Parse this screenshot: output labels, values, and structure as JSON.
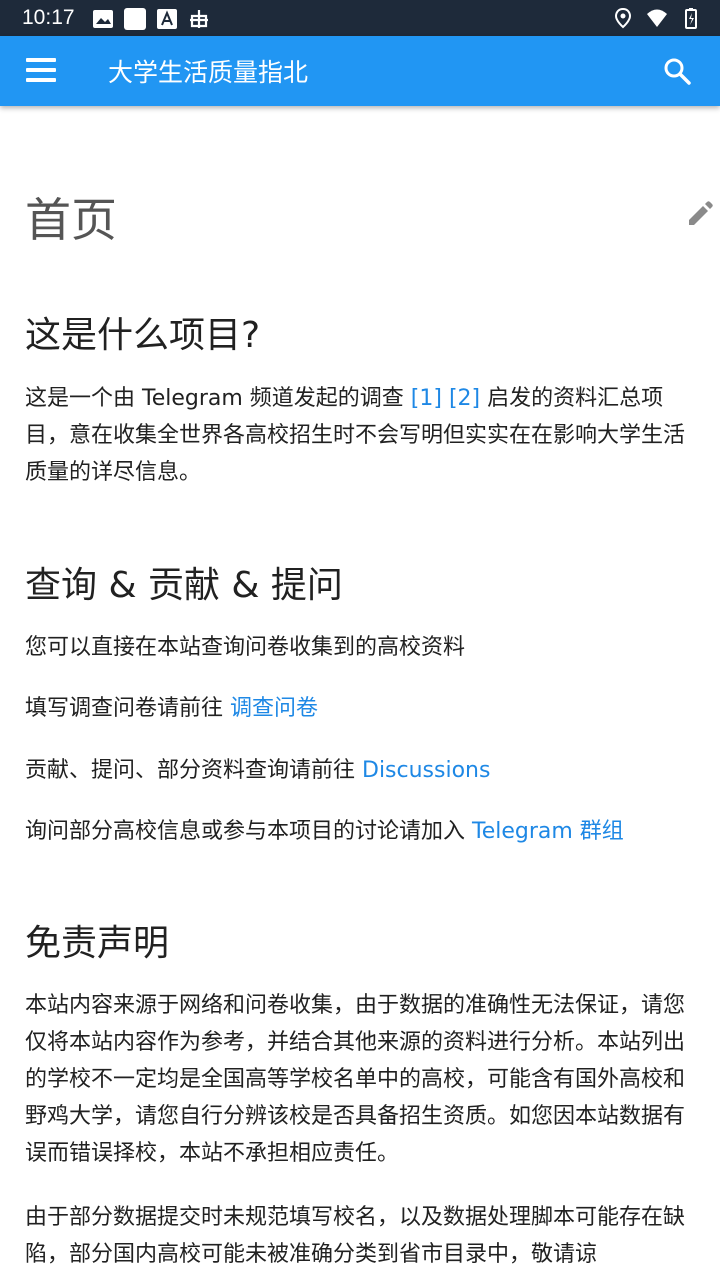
{
  "status_bar": {
    "time": "10:17",
    "icons_left": [
      "image-icon",
      "square-icon",
      "font-icon",
      "bug-icon"
    ],
    "icons_right": [
      "location-icon",
      "wifi-icon",
      "battery-icon"
    ]
  },
  "app_bar": {
    "title": "大学生活质量指北",
    "menu_icon": "menu-icon",
    "search_icon": "search-icon",
    "color": "#2196f3"
  },
  "page": {
    "title": "首页",
    "edit_icon": "pencil-icon"
  },
  "sections": {
    "about": {
      "heading": "这是什么项目?",
      "text_before": "这是一个由 Telegram 频道发起的调查 ",
      "ref1": "[1]",
      "ref2": "[2]",
      "text_after": " 启发的资料汇总项目，意在收集全世界各高校招生时不会写明但实实在在影响大学生活质量的详尽信息。"
    },
    "query": {
      "heading": "查询 & 贡献 & 提问",
      "line1": "您可以直接在本站查询问卷收集到的高校资料",
      "line2_text": "填写调查问卷请前往 ",
      "line2_link": "调查问卷",
      "line3_text": "贡献、提问、部分资料查询请前往 ",
      "line3_link": "Discussions",
      "line4_text": "询问部分高校信息或参与本项目的讨论请加入 ",
      "line4_link": "Telegram 群组"
    },
    "disclaimer": {
      "heading": "免责声明",
      "para1": "本站内容来源于网络和问卷收集，由于数据的准确性无法保证，请您仅将本站内容作为参考，并结合其他来源的资料进行分析。本站列出的学校不一定均是全国高等学校名单中的高校，可能含有国外高校和野鸡大学，请您自行分辨该校是否具备招生资质。如您因本站数据有误而错误择校，本站不承担相应责任。",
      "para2": "由于部分数据提交时未规范填写校名，以及数据处理脚本可能存在缺陷，部分国内高校可能未被准确分类到省市目录中，敬请谅"
    }
  }
}
